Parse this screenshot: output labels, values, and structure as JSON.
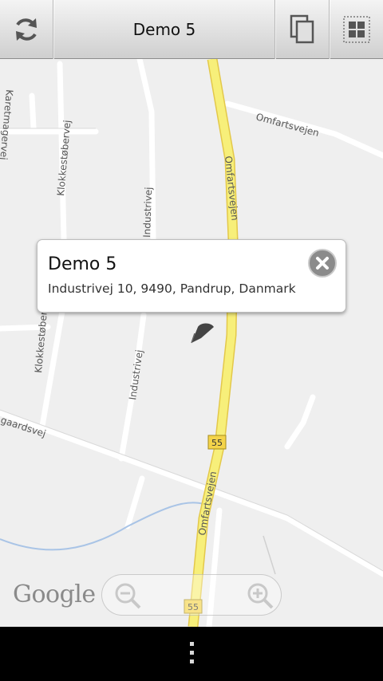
{
  "toolbar": {
    "title": "Demo 5"
  },
  "map": {
    "streets": [
      "Karetmagervej",
      "Klokkestøbervej",
      "Industrivej",
      "Omfartsvejen",
      "Omfartsvejen",
      "Industrivej",
      "Klokkestøbervej",
      "Omfartsvejen",
      "gaardsvej"
    ],
    "road_shields": [
      "55",
      "55"
    ],
    "attribution": "Google"
  },
  "popup": {
    "title": "Demo 5",
    "address": "Industrivej 10, 9490, Pandrup, Danmark"
  },
  "colors": {
    "map_background": "#efefef",
    "road_main": "#f7ef7a",
    "road_main_edge": "#e3c84a",
    "toolbar_gradient_top": "#f4f4f4",
    "toolbar_gradient_bottom": "#cfcfcf"
  },
  "icons": {
    "refresh": "refresh-icon",
    "copy": "copy-icon",
    "grid": "grid-icon",
    "close": "close-icon",
    "zoom_out": "zoom-out-icon",
    "zoom_in": "zoom-in-icon",
    "marker": "map-marker-icon",
    "menu": "overflow-menu-icon"
  }
}
